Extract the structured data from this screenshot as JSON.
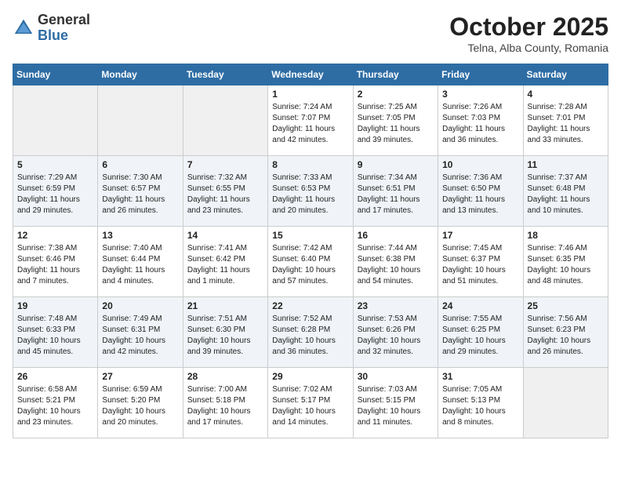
{
  "header": {
    "logo_general": "General",
    "logo_blue": "Blue",
    "month_title": "October 2025",
    "location": "Telna, Alba County, Romania"
  },
  "days_of_week": [
    "Sunday",
    "Monday",
    "Tuesday",
    "Wednesday",
    "Thursday",
    "Friday",
    "Saturday"
  ],
  "weeks": [
    [
      {
        "day": "",
        "info": "",
        "empty": true
      },
      {
        "day": "",
        "info": "",
        "empty": true
      },
      {
        "day": "",
        "info": "",
        "empty": true
      },
      {
        "day": "1",
        "info": "Sunrise: 7:24 AM\nSunset: 7:07 PM\nDaylight: 11 hours and 42 minutes.",
        "empty": false
      },
      {
        "day": "2",
        "info": "Sunrise: 7:25 AM\nSunset: 7:05 PM\nDaylight: 11 hours and 39 minutes.",
        "empty": false
      },
      {
        "day": "3",
        "info": "Sunrise: 7:26 AM\nSunset: 7:03 PM\nDaylight: 11 hours and 36 minutes.",
        "empty": false
      },
      {
        "day": "4",
        "info": "Sunrise: 7:28 AM\nSunset: 7:01 PM\nDaylight: 11 hours and 33 minutes.",
        "empty": false
      }
    ],
    [
      {
        "day": "5",
        "info": "Sunrise: 7:29 AM\nSunset: 6:59 PM\nDaylight: 11 hours and 29 minutes.",
        "empty": false
      },
      {
        "day": "6",
        "info": "Sunrise: 7:30 AM\nSunset: 6:57 PM\nDaylight: 11 hours and 26 minutes.",
        "empty": false
      },
      {
        "day": "7",
        "info": "Sunrise: 7:32 AM\nSunset: 6:55 PM\nDaylight: 11 hours and 23 minutes.",
        "empty": false
      },
      {
        "day": "8",
        "info": "Sunrise: 7:33 AM\nSunset: 6:53 PM\nDaylight: 11 hours and 20 minutes.",
        "empty": false
      },
      {
        "day": "9",
        "info": "Sunrise: 7:34 AM\nSunset: 6:51 PM\nDaylight: 11 hours and 17 minutes.",
        "empty": false
      },
      {
        "day": "10",
        "info": "Sunrise: 7:36 AM\nSunset: 6:50 PM\nDaylight: 11 hours and 13 minutes.",
        "empty": false
      },
      {
        "day": "11",
        "info": "Sunrise: 7:37 AM\nSunset: 6:48 PM\nDaylight: 11 hours and 10 minutes.",
        "empty": false
      }
    ],
    [
      {
        "day": "12",
        "info": "Sunrise: 7:38 AM\nSunset: 6:46 PM\nDaylight: 11 hours and 7 minutes.",
        "empty": false
      },
      {
        "day": "13",
        "info": "Sunrise: 7:40 AM\nSunset: 6:44 PM\nDaylight: 11 hours and 4 minutes.",
        "empty": false
      },
      {
        "day": "14",
        "info": "Sunrise: 7:41 AM\nSunset: 6:42 PM\nDaylight: 11 hours and 1 minute.",
        "empty": false
      },
      {
        "day": "15",
        "info": "Sunrise: 7:42 AM\nSunset: 6:40 PM\nDaylight: 10 hours and 57 minutes.",
        "empty": false
      },
      {
        "day": "16",
        "info": "Sunrise: 7:44 AM\nSunset: 6:38 PM\nDaylight: 10 hours and 54 minutes.",
        "empty": false
      },
      {
        "day": "17",
        "info": "Sunrise: 7:45 AM\nSunset: 6:37 PM\nDaylight: 10 hours and 51 minutes.",
        "empty": false
      },
      {
        "day": "18",
        "info": "Sunrise: 7:46 AM\nSunset: 6:35 PM\nDaylight: 10 hours and 48 minutes.",
        "empty": false
      }
    ],
    [
      {
        "day": "19",
        "info": "Sunrise: 7:48 AM\nSunset: 6:33 PM\nDaylight: 10 hours and 45 minutes.",
        "empty": false
      },
      {
        "day": "20",
        "info": "Sunrise: 7:49 AM\nSunset: 6:31 PM\nDaylight: 10 hours and 42 minutes.",
        "empty": false
      },
      {
        "day": "21",
        "info": "Sunrise: 7:51 AM\nSunset: 6:30 PM\nDaylight: 10 hours and 39 minutes.",
        "empty": false
      },
      {
        "day": "22",
        "info": "Sunrise: 7:52 AM\nSunset: 6:28 PM\nDaylight: 10 hours and 36 minutes.",
        "empty": false
      },
      {
        "day": "23",
        "info": "Sunrise: 7:53 AM\nSunset: 6:26 PM\nDaylight: 10 hours and 32 minutes.",
        "empty": false
      },
      {
        "day": "24",
        "info": "Sunrise: 7:55 AM\nSunset: 6:25 PM\nDaylight: 10 hours and 29 minutes.",
        "empty": false
      },
      {
        "day": "25",
        "info": "Sunrise: 7:56 AM\nSunset: 6:23 PM\nDaylight: 10 hours and 26 minutes.",
        "empty": false
      }
    ],
    [
      {
        "day": "26",
        "info": "Sunrise: 6:58 AM\nSunset: 5:21 PM\nDaylight: 10 hours and 23 minutes.",
        "empty": false
      },
      {
        "day": "27",
        "info": "Sunrise: 6:59 AM\nSunset: 5:20 PM\nDaylight: 10 hours and 20 minutes.",
        "empty": false
      },
      {
        "day": "28",
        "info": "Sunrise: 7:00 AM\nSunset: 5:18 PM\nDaylight: 10 hours and 17 minutes.",
        "empty": false
      },
      {
        "day": "29",
        "info": "Sunrise: 7:02 AM\nSunset: 5:17 PM\nDaylight: 10 hours and 14 minutes.",
        "empty": false
      },
      {
        "day": "30",
        "info": "Sunrise: 7:03 AM\nSunset: 5:15 PM\nDaylight: 10 hours and 11 minutes.",
        "empty": false
      },
      {
        "day": "31",
        "info": "Sunrise: 7:05 AM\nSunset: 5:13 PM\nDaylight: 10 hours and 8 minutes.",
        "empty": false
      },
      {
        "day": "",
        "info": "",
        "empty": true
      }
    ]
  ]
}
